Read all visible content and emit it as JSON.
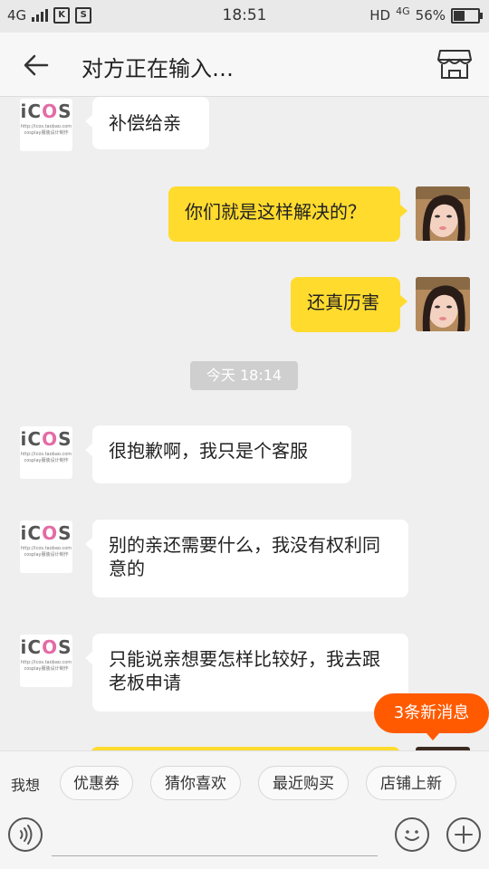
{
  "status_bar": {
    "network": "4G",
    "app_icon_1": "K",
    "app_icon_2": "S",
    "time": "18:51",
    "hd": "HD",
    "network_right": "4G",
    "battery_percent": "56%",
    "battery_level": 0.56
  },
  "header": {
    "title": "对方正在输入…",
    "back_icon": "back-arrow-icon",
    "shop_icon": "shop-icon"
  },
  "logo": {
    "text_i": "i",
    "text_c": "C",
    "text_o": "O",
    "text_s": "S",
    "sub1": "http://icos.taobao.com",
    "sub2": "cosplay服装设计制作"
  },
  "messages": [
    {
      "side": "left",
      "text": "补偿给亲"
    },
    {
      "side": "right",
      "text": "你们就是这样解决的？"
    },
    {
      "side": "right",
      "text": "还真历害"
    },
    {
      "side": "left",
      "text": "很抱歉啊，我只是个客服"
    },
    {
      "side": "left",
      "text": "别的亲还需要什么，我没有权利同意的"
    },
    {
      "side": "left",
      "text": "只能说亲想要怎样比较好，我去跟老板申请"
    }
  ],
  "time_divider": "今天 18:14",
  "new_messages_badge": "3条新消息",
  "quick_bar": {
    "label": "我想",
    "chips": [
      "优惠券",
      "猜你喜欢",
      "最近购买",
      "店铺上新"
    ]
  },
  "input_bar": {
    "voice_icon": "voice-icon",
    "emoji_icon": "emoji-icon",
    "plus_icon": "plus-icon"
  }
}
